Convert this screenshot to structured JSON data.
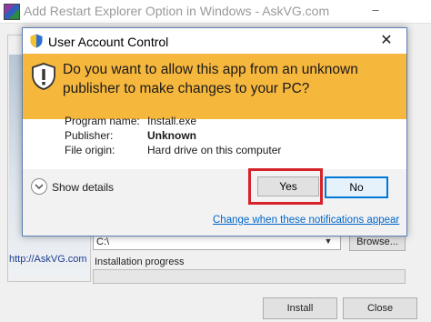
{
  "background_window": {
    "title": "Add Restart Explorer Option in Windows - AskVG.com",
    "minimize_glyph": "–",
    "site_link": "http://AskVG.com",
    "path_value": "C:\\",
    "browse_label": "Browse...",
    "progress_label": "Installation progress",
    "progress": 0,
    "install_label": "Install",
    "close_label": "Close"
  },
  "uac": {
    "title": "User Account Control",
    "close_glyph": "✕",
    "question": "Do you want to allow this app from an unknown publisher to make changes to your PC?",
    "details": [
      {
        "label": "Program name:",
        "value": "Install.exe",
        "bold": false
      },
      {
        "label": "Publisher:",
        "value": "Unknown",
        "bold": true
      },
      {
        "label": "File origin:",
        "value": "Hard drive on this computer",
        "bold": false
      }
    ],
    "show_details": "Show details",
    "yes_label": "Yes",
    "no_label": "No",
    "change_link": "Change when these notifications appear"
  },
  "colors": {
    "banner": "#f6b73d",
    "accent": "#0078d7",
    "highlight": "#d6232b",
    "link": "#0066cc"
  },
  "icons": {
    "app": "installer-app-icon",
    "shield": "uac-shield-icon",
    "warning": "warning-shield-icon",
    "expand": "chevron-down-icon",
    "dropdown": "dropdown-arrow-icon"
  }
}
